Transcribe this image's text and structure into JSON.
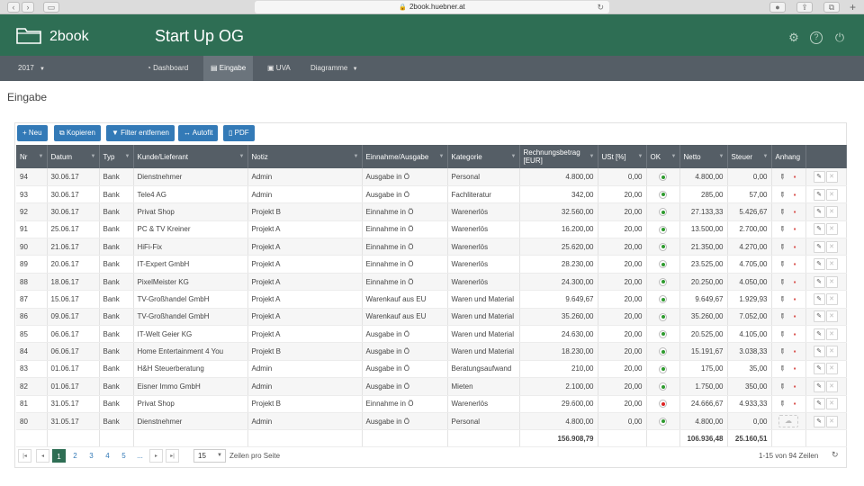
{
  "browser": {
    "url": "2book.huebner.at"
  },
  "header": {
    "brand": "2book",
    "company": "Start Up OG"
  },
  "nav": {
    "year": "2017",
    "items": [
      {
        "label": "Dashboard",
        "icon": "dashboard-icon"
      },
      {
        "label": "Eingabe",
        "icon": "table-icon",
        "active": true
      },
      {
        "label": "UVA",
        "icon": "money-icon"
      },
      {
        "label": "Diagramme",
        "icon": "chevron-down-icon"
      }
    ]
  },
  "page": {
    "title": "Eingabe"
  },
  "toolbar": {
    "new_label": "Neu",
    "copy_label": "Kopieren",
    "filter_label": "Filter entfernen",
    "autofit_label": "Autofit",
    "pdf_label": "PDF"
  },
  "table": {
    "columns": [
      "Nr",
      "Datum",
      "Typ",
      "Kunde/Lieferant",
      "Notiz",
      "Einnahme/Ausgabe",
      "Kategorie",
      "Rechnungsbetrag [EUR]",
      "USt [%]",
      "OK",
      "Netto",
      "Steuer",
      "Anhang",
      ""
    ],
    "rows": [
      {
        "nr": "94",
        "datum": "30.06.17",
        "typ": "Bank",
        "kunde": "Dienstnehmer",
        "notiz": "Admin",
        "ea": "Ausgabe in Ö",
        "kat": "Personal",
        "betrag": "4.800,00",
        "ust": "0,00",
        "ok": "green",
        "netto": "4.800,00",
        "steuer": "0,00",
        "anhang": true
      },
      {
        "nr": "93",
        "datum": "30.06.17",
        "typ": "Bank",
        "kunde": "Tele4 AG",
        "notiz": "Admin",
        "ea": "Ausgabe in Ö",
        "kat": "Fachliteratur",
        "betrag": "342,00",
        "ust": "20,00",
        "ok": "green",
        "netto": "285,00",
        "steuer": "57,00",
        "anhang": true
      },
      {
        "nr": "92",
        "datum": "30.06.17",
        "typ": "Bank",
        "kunde": "Privat Shop",
        "notiz": "Projekt B",
        "ea": "Einnahme in Ö",
        "kat": "Warenerlös",
        "betrag": "32.560,00",
        "ust": "20,00",
        "ok": "green",
        "netto": "27.133,33",
        "steuer": "5.426,67",
        "anhang": true
      },
      {
        "nr": "91",
        "datum": "25.06.17",
        "typ": "Bank",
        "kunde": "PC & TV Kreiner",
        "notiz": "Projekt A",
        "ea": "Einnahme in Ö",
        "kat": "Warenerlös",
        "betrag": "16.200,00",
        "ust": "20,00",
        "ok": "green",
        "netto": "13.500,00",
        "steuer": "2.700,00",
        "anhang": true
      },
      {
        "nr": "90",
        "datum": "21.06.17",
        "typ": "Bank",
        "kunde": "HiFi-Fix",
        "notiz": "Projekt A",
        "ea": "Einnahme in Ö",
        "kat": "Warenerlös",
        "betrag": "25.620,00",
        "ust": "20,00",
        "ok": "green",
        "netto": "21.350,00",
        "steuer": "4.270,00",
        "anhang": true
      },
      {
        "nr": "89",
        "datum": "20.06.17",
        "typ": "Bank",
        "kunde": "IT-Expert GmbH",
        "notiz": "Projekt A",
        "ea": "Einnahme in Ö",
        "kat": "Warenerlös",
        "betrag": "28.230,00",
        "ust": "20,00",
        "ok": "green",
        "netto": "23.525,00",
        "steuer": "4.705,00",
        "anhang": true
      },
      {
        "nr": "88",
        "datum": "18.06.17",
        "typ": "Bank",
        "kunde": "PixelMeister KG",
        "notiz": "Projekt A",
        "ea": "Einnahme in Ö",
        "kat": "Warenerlös",
        "betrag": "24.300,00",
        "ust": "20,00",
        "ok": "green",
        "netto": "20.250,00",
        "steuer": "4.050,00",
        "anhang": true
      },
      {
        "nr": "87",
        "datum": "15.06.17",
        "typ": "Bank",
        "kunde": "TV-Großhandel GmbH",
        "notiz": "Projekt A",
        "ea": "Warenkauf aus EU",
        "kat": "Waren und Material",
        "betrag": "9.649,67",
        "ust": "20,00",
        "ok": "green",
        "netto": "9.649,67",
        "steuer": "1.929,93",
        "anhang": true
      },
      {
        "nr": "86",
        "datum": "09.06.17",
        "typ": "Bank",
        "kunde": "TV-Großhandel GmbH",
        "notiz": "Projekt A",
        "ea": "Warenkauf aus EU",
        "kat": "Waren und Material",
        "betrag": "35.260,00",
        "ust": "20,00",
        "ok": "green",
        "netto": "35.260,00",
        "steuer": "7.052,00",
        "anhang": true
      },
      {
        "nr": "85",
        "datum": "06.06.17",
        "typ": "Bank",
        "kunde": "IT-Welt Geier KG",
        "notiz": "Projekt A",
        "ea": "Ausgabe in Ö",
        "kat": "Waren und Material",
        "betrag": "24.630,00",
        "ust": "20,00",
        "ok": "green",
        "netto": "20.525,00",
        "steuer": "4.105,00",
        "anhang": true
      },
      {
        "nr": "84",
        "datum": "06.06.17",
        "typ": "Bank",
        "kunde": "Home Entertainment 4 You",
        "notiz": "Projekt B",
        "ea": "Ausgabe in Ö",
        "kat": "Waren und Material",
        "betrag": "18.230,00",
        "ust": "20,00",
        "ok": "green",
        "netto": "15.191,67",
        "steuer": "3.038,33",
        "anhang": true
      },
      {
        "nr": "83",
        "datum": "01.06.17",
        "typ": "Bank",
        "kunde": "H&H Steuerberatung",
        "notiz": "Admin",
        "ea": "Ausgabe in Ö",
        "kat": "Beratungsaufwand",
        "betrag": "210,00",
        "ust": "20,00",
        "ok": "green",
        "netto": "175,00",
        "steuer": "35,00",
        "anhang": true
      },
      {
        "nr": "82",
        "datum": "01.06.17",
        "typ": "Bank",
        "kunde": "Eisner Immo GmbH",
        "notiz": "Admin",
        "ea": "Ausgabe in Ö",
        "kat": "Mieten",
        "betrag": "2.100,00",
        "ust": "20,00",
        "ok": "green",
        "netto": "1.750,00",
        "steuer": "350,00",
        "anhang": true
      },
      {
        "nr": "81",
        "datum": "31.05.17",
        "typ": "Bank",
        "kunde": "Privat Shop",
        "notiz": "Projekt B",
        "ea": "Einnahme in Ö",
        "kat": "Warenerlös",
        "betrag": "29.600,00",
        "ust": "20,00",
        "ok": "red",
        "netto": "24.666,67",
        "steuer": "4.933,33",
        "anhang": true
      },
      {
        "nr": "80",
        "datum": "31.05.17",
        "typ": "Bank",
        "kunde": "Dienstnehmer",
        "notiz": "Admin",
        "ea": "Ausgabe in Ö",
        "kat": "Personal",
        "betrag": "4.800,00",
        "ust": "0,00",
        "ok": "green",
        "netto": "4.800,00",
        "steuer": "0,00",
        "anhang": false
      }
    ],
    "totals": {
      "betrag": "156.908,79",
      "netto": "106.936,48",
      "steuer": "25.160,51"
    }
  },
  "pagination": {
    "pages": [
      "1",
      "2",
      "3",
      "4",
      "5",
      "..."
    ],
    "active_page": "1",
    "page_size": "15",
    "rows_label": "Zeilen pro Seite",
    "range_label": "1-15 von 94 Zeilen"
  },
  "colors": {
    "header": "#2e6e54",
    "nav": "#555e66",
    "button": "#337ab7",
    "ok_green": "#2e9a2e",
    "ok_red": "#dd2222"
  }
}
